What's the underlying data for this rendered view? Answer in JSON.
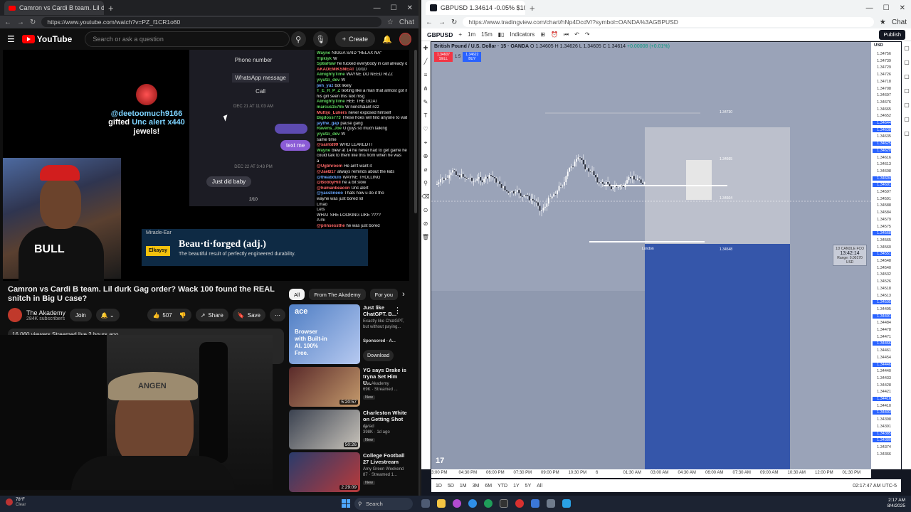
{
  "left_browser": {
    "tab_title": "Camron vs Cardi B team. Lil d...",
    "url": "https://www.youtube.com/watch?v=PZ_f1CR1o60",
    "profile_label": "Chat"
  },
  "youtube": {
    "logo": "YouTube",
    "search_placeholder": "Search or ask a question",
    "create_label": "Create",
    "video_title": "Camron vs Cardi B team. Lil durk Gag order? Wack 100 found the REAL snitch in Big U case?",
    "channel_name": "The Akademy",
    "channel_subs": "284K subscribers",
    "join_label": "Join",
    "likes": "507",
    "share_label": "Share",
    "save_label": "Save",
    "description_meta": "16,060 viewers  Streamed live 2 hours ago",
    "chips": [
      "All",
      "From The Akademy",
      "For you"
    ],
    "ad_card": {
      "brand": "ace",
      "body": "Browser with Built-in AI. 100% Free.",
      "title": "Just like ChatGPT. B...",
      "meta": "Exactly like ChatGPT, but without paying...",
      "sponsored": "Sponsored · A...",
      "button": "Download"
    },
    "recommendations": [
      {
        "title": "YG says Drake is tryna Set Him U...",
        "channel": "The Akademy",
        "meta": "69K · Streamed ...",
        "badge": "New",
        "duration": "5:20:57"
      },
      {
        "title": "Charleston White on Getting Shot ...",
        "channel": "djvlad",
        "meta": "398K · 1d ago",
        "badge": "New",
        "duration": "50:26"
      },
      {
        "title": "College Football 27 Livestream",
        "channel": "Amy Green Weekend",
        "meta": "87 · Streamed 1...",
        "badge": "New",
        "duration": "2:29:09"
      }
    ]
  },
  "stream_overlay": {
    "gift_user": "@deetoomuch9166",
    "gift_text_pre": "gifted",
    "gift_item": "Unc alert",
    "gift_count": "x440",
    "gift_suffix": "jewels!",
    "phone_number_label": "Phone number",
    "whatsapp_label": "WhatsApp message",
    "call_label": "Call",
    "date1": "DEC 21 AT 11:03 AM",
    "date2": "DEC 22 AT 3:43 PM",
    "msg_text_me": "text me",
    "msg_just_did": "Just did baby",
    "page_indicator": "2/10",
    "ad_top": "Miracle-Ear",
    "ad_logo": "Elkaysy",
    "ad_headline": "Beau·ti·forged (adj.)",
    "ad_sub": "The beautiful result of perfectly engineered durability.",
    "webcam_cap_text": "BULL",
    "webcam2_band": "ANGEN",
    "chat": [
      {
        "n": "Wayne",
        "t": "NIGGA SAID \"RELAX NA\"",
        "c": "g"
      },
      {
        "n": "Ylpkiyk",
        "t": "W",
        "c": "g"
      },
      {
        "n": "Sp8aRaw",
        "t": "he fucked everybody in call already ok",
        "c": "g"
      },
      {
        "n": "AKADEMIKSMEAT",
        "t": "10/10",
        "c": "r"
      },
      {
        "n": "AlmightyTime",
        "t": "WAYNE DO NEED RIZZ",
        "c": "g"
      },
      {
        "n": "yiyutzi_dev",
        "t": "W",
        "c": "g"
      },
      {
        "n": "jwn_yuz",
        "t": "bot likely",
        "c": "b"
      },
      {
        "n": "T_E_R_P_Z",
        "t": "texting like a man that almost got married but",
        "c": "g"
      },
      {
        "n": "",
        "t": "his girl seen this text msg",
        "c": "g"
      },
      {
        "n": "AlmightyTime",
        "t": "HEE THE GOAT",
        "c": "g"
      },
      {
        "n": "marcus15765",
        "t": "W nonchalant rizz",
        "c": "g"
      },
      {
        "n": "Multijo_Lukers",
        "t": "never exposed himself",
        "c": "r"
      },
      {
        "n": "Bigdoss773",
        "t": "These hoes will find anyone to watch their kids",
        "c": "g"
      },
      {
        "n": "jaythe_gap",
        "t": "pause gang",
        "c": "b"
      },
      {
        "n": "Ravens_Joe",
        "t": "U guys so much talking",
        "c": "g"
      },
      {
        "n": "yiyutzi_dev",
        "t": "W",
        "c": "g"
      },
      {
        "n": "",
        "t": "same time",
        "c": "g"
      },
      {
        "n": "@saintd99",
        "t": "WHO LEAKED IT",
        "c": "r"
      },
      {
        "n": "Wayne",
        "t": "blew at 14 he never had to get game he",
        "c": "g"
      },
      {
        "n": "",
        "t": "could talk to them like this from when he was",
        "c": "g"
      },
      {
        "n": "",
        "t": "a",
        "c": "g"
      },
      {
        "n": "@Ugbhroom",
        "t": "He ain't want it",
        "c": "r"
      },
      {
        "n": "@JaeB17",
        "t": "always reminds about the kids",
        "c": "r"
      },
      {
        "n": "@theabdulo",
        "t": "WAYNE TROLLING",
        "c": "b"
      },
      {
        "n": "@BobbyHill",
        "t": "he a bit slow",
        "c": "r"
      },
      {
        "n": "@humanbeacon",
        "t": "Unc alert",
        "c": "r"
      },
      {
        "n": "@yasslineoo",
        "t": "Thats how u do it tho",
        "c": "b"
      },
      {
        "n": "",
        "t": "wayne was just bored lol",
        "c": "g"
      },
      {
        "n": "",
        "t": "Lmao",
        "c": "g"
      },
      {
        "n": "",
        "t": "Lets",
        "c": "g"
      },
      {
        "n": "",
        "t": "WHAT SHE LOOKING LIKE ????",
        "c": "g"
      },
      {
        "n": "",
        "t": "A mi",
        "c": "g"
      },
      {
        "n": "@prinsessthe",
        "t": "he was just bored",
        "c": "r"
      }
    ]
  },
  "right_browser": {
    "tab_title": "GBPUSD 1.34614 -0.05% $100...",
    "url": "https://www.tradingview.com/chart/hNp4DcdV/?symbol=OANDA%3AGBPUSD",
    "profile_label": "Chat"
  },
  "tradingview": {
    "symbol": "GBPUSD",
    "interval_options": [
      "1m",
      "15m"
    ],
    "indicators_label": "Indicators",
    "publish_label": "Publish",
    "currency": "USD",
    "legend": "British Pound / U.S. Dollar · 15 · OANDA",
    "ohlc": {
      "o": "O 1.34605",
      "h": "H 1.34626",
      "l": "L 1.34605",
      "c": "C 1.34614",
      "chg": "+0.00008 (+0.01%)"
    },
    "sell_price": "1.34607",
    "sell_label": "SELL",
    "spread": "1.5",
    "buy_price": "1.34622",
    "buy_label": "BUY",
    "session_label": "London",
    "level_labels": [
      "1.34730",
      "1.34665",
      "1.34604",
      "1.34548"
    ],
    "candle_tip_title": "1D CANDLE FCO",
    "candle_tip_time": "13:42:14",
    "candle_tip_range": "Range: 0.00170 USD",
    "price_axis": [
      "1.34756",
      "1.34739",
      "1.34729",
      "1.34726",
      "1.34718",
      "1.34708",
      "1.34697",
      "1.34676",
      "1.34665",
      "1.34652",
      "1.34644",
      "1.34638",
      "1.34635",
      "1.34625",
      "1.34620",
      "1.34616",
      "1.34613",
      "1.34608",
      "1.34604",
      "1.34601",
      "1.34597",
      "1.34591",
      "1.34588",
      "1.34584",
      "1.34579",
      "1.34575",
      "1.34568",
      "1.34565",
      "1.34560",
      "1.34551",
      "1.34548",
      "1.34540",
      "1.34532",
      "1.34526",
      "1.34518",
      "1.34513",
      "1.34505",
      "1.34495",
      "1.34491",
      "1.34484",
      "1.34478",
      "1.34471",
      "1.34466",
      "1.34461",
      "1.34454",
      "1.34446",
      "1.34440",
      "1.34433",
      "1.34428",
      "1.34421",
      "1.34416",
      "1.34410",
      "1.34403",
      "1.34398",
      "1.34391",
      "1.34385",
      "1.34380",
      "1.34374",
      "1.34366"
    ],
    "time_axis": [
      "3:00 PM",
      "04:30 PM",
      "06:00 PM",
      "07:30 PM",
      "09:00 PM",
      "10:30 PM",
      "6",
      "01:30 AM",
      "03:00 AM",
      "04:30 AM",
      "06:00 AM",
      "07:30 AM",
      "09:00 AM",
      "10:30 AM",
      "12:00 PM",
      "01:30 PM"
    ],
    "ranges": [
      "1D",
      "5D",
      "1M",
      "3M",
      "6M",
      "YTD",
      "1Y",
      "5Y",
      "All"
    ],
    "clock": "02:17:47 AM UTC-5"
  },
  "taskbar": {
    "temp": "78°F",
    "condition": "Clear",
    "search_label": "Search",
    "time": "2:17 AM",
    "date": "8/4/2025"
  },
  "colors": {
    "youtube_red": "#ff0000",
    "tv_blue": "#2962ff",
    "tv_red": "#f23645",
    "chart_bg": "#9aa3b8"
  }
}
